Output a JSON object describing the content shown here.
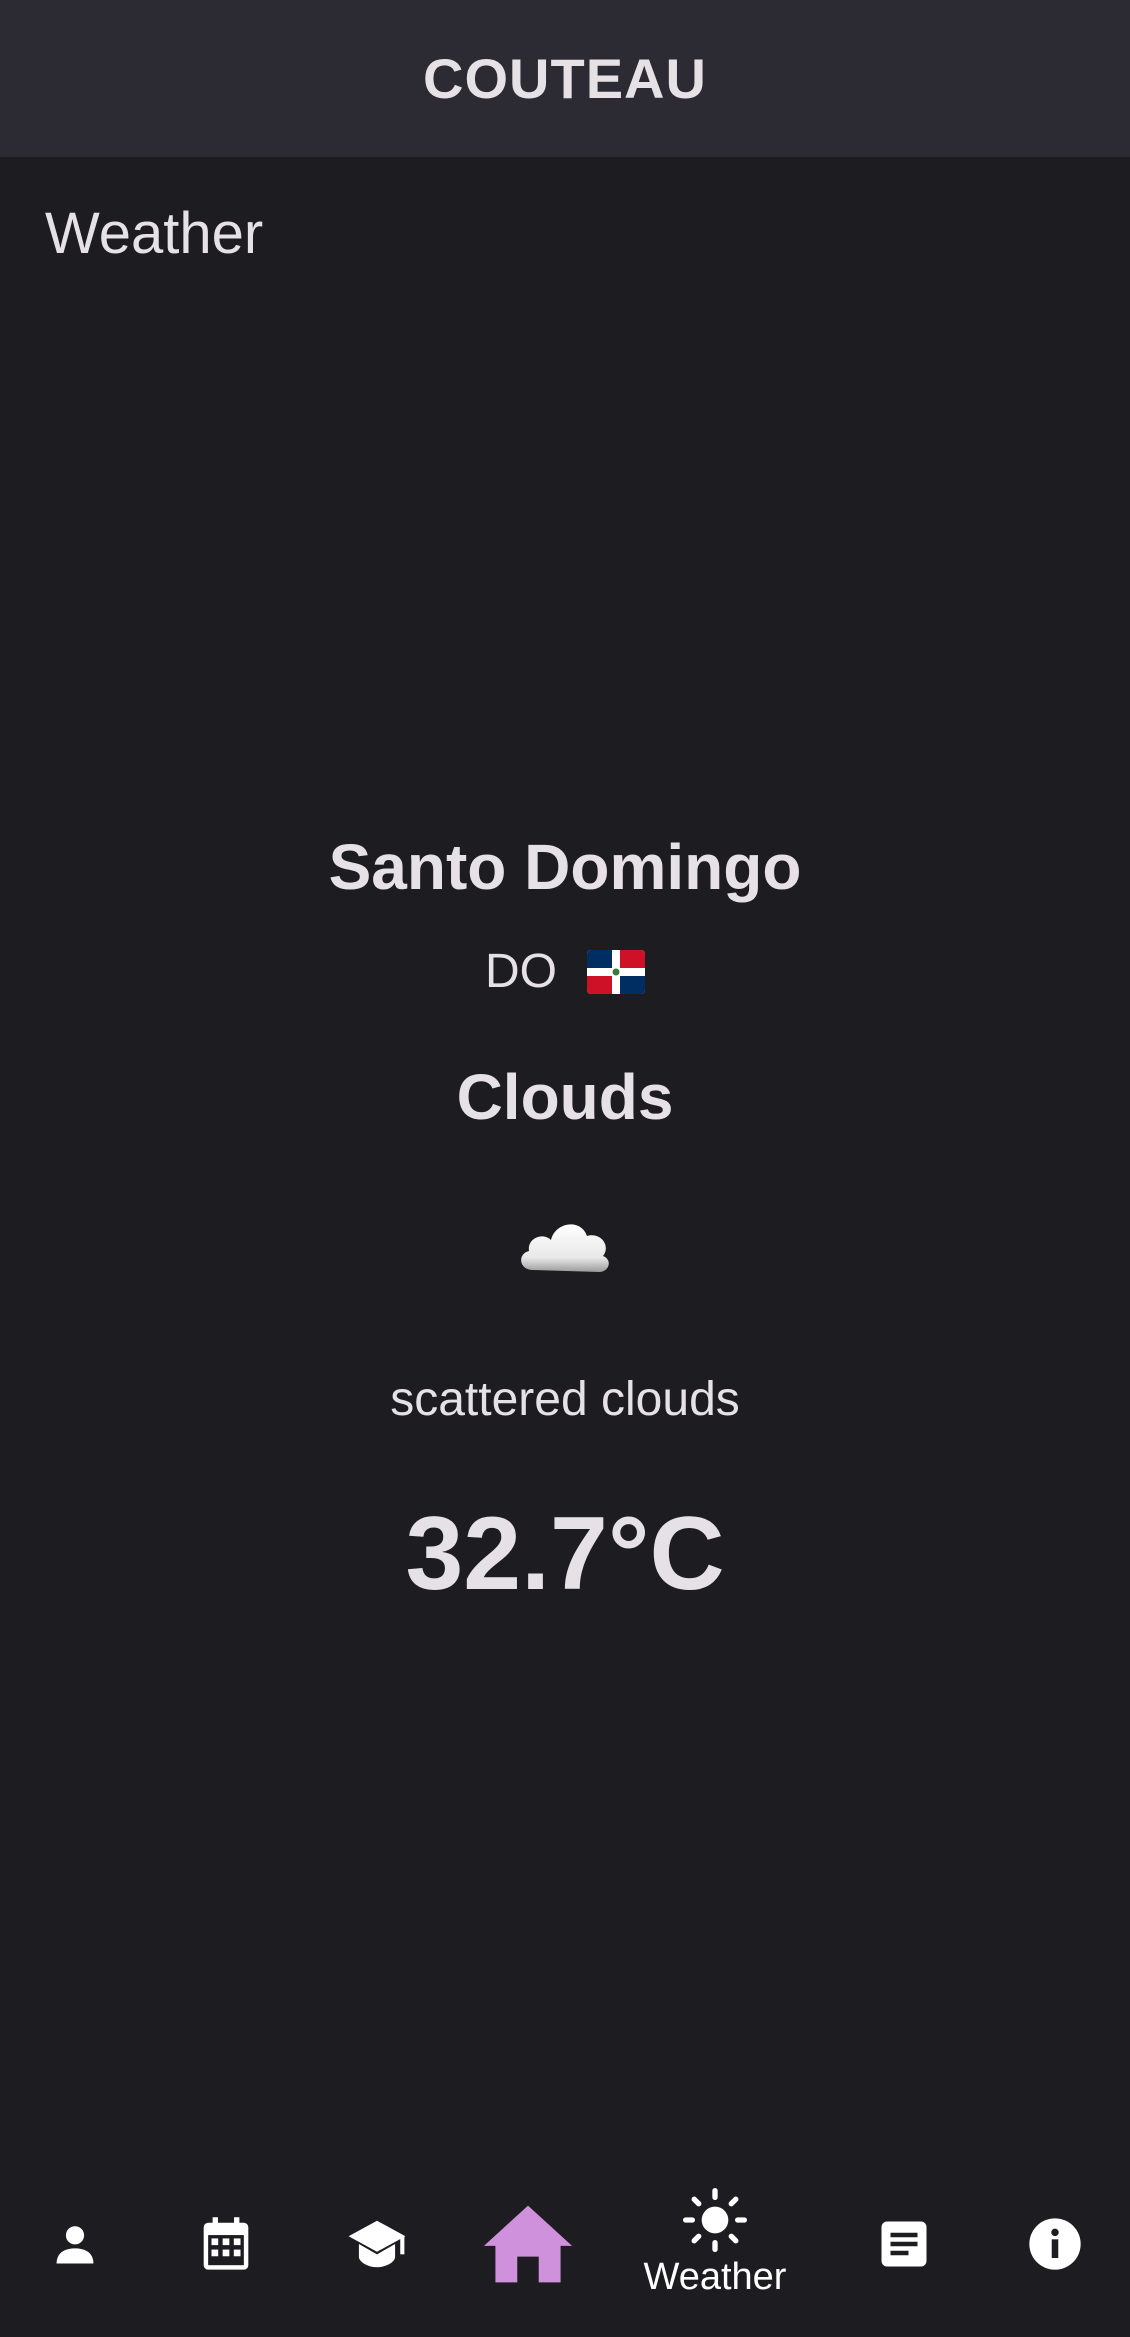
{
  "app": {
    "title": "COUTEAU"
  },
  "page": {
    "heading": "Weather"
  },
  "weather": {
    "city": "Santo Domingo",
    "country_code": "DO",
    "condition": "Clouds",
    "description": "scattered clouds",
    "temperature": "32.7°C",
    "icon": "cloud-icon"
  },
  "nav": {
    "active_index": 3,
    "active_color": "#d091dc",
    "items": [
      {
        "icon": "person-icon",
        "label": ""
      },
      {
        "icon": "calendar-icon",
        "label": ""
      },
      {
        "icon": "graduation-cap-icon",
        "label": ""
      },
      {
        "icon": "home-icon",
        "label": ""
      },
      {
        "icon": "sun-icon",
        "label": "Weather"
      },
      {
        "icon": "article-icon",
        "label": ""
      },
      {
        "icon": "info-icon",
        "label": ""
      }
    ]
  },
  "colors": {
    "background": "#1d1c21",
    "appbar": "#2c2a33",
    "text": "#e6e1e5"
  }
}
